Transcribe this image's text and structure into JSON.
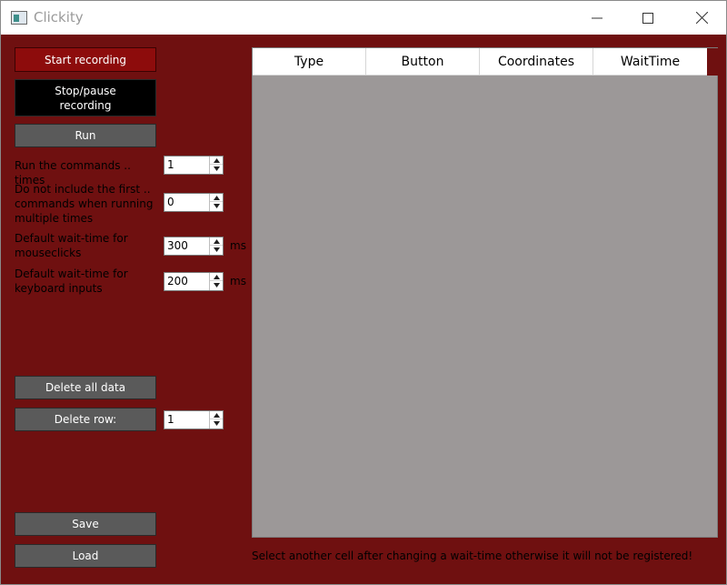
{
  "window": {
    "title": "Clickity",
    "minimize_icon": "minimize-icon",
    "maximize_icon": "maximize-icon",
    "close_icon": "close-icon"
  },
  "controls": {
    "start_recording": "Start recording",
    "stop_pause_recording": "Stop/pause recording",
    "run": "Run",
    "delete_all_data": "Delete all data",
    "delete_row": "Delete row:",
    "save": "Save",
    "load": "Load"
  },
  "settings": {
    "run_times_label": "Run the commands .. times",
    "run_times_value": "1",
    "skip_first_label": "Do not include the first .. commands when running multiple times",
    "skip_first_value": "0",
    "mouse_wait_label": "Default wait-time for mouseclicks",
    "mouse_wait_value": "300",
    "mouse_wait_unit": "ms",
    "keyboard_wait_label": "Default wait-time for keyboard inputs",
    "keyboard_wait_value": "200",
    "keyboard_wait_unit": "ms",
    "delete_row_value": "1"
  },
  "table": {
    "columns": [
      "Type",
      "Button",
      "Coordinates",
      "WaitTime"
    ],
    "rows": []
  },
  "status": {
    "message": "Select another cell after changing a wait-time otherwise it will not be registered!"
  },
  "colors": {
    "background": "#6f1010",
    "button_grey": "#5a5a5a",
    "button_red": "#8d0c0c",
    "button_black": "#000000",
    "table_bg": "#9c9898"
  }
}
